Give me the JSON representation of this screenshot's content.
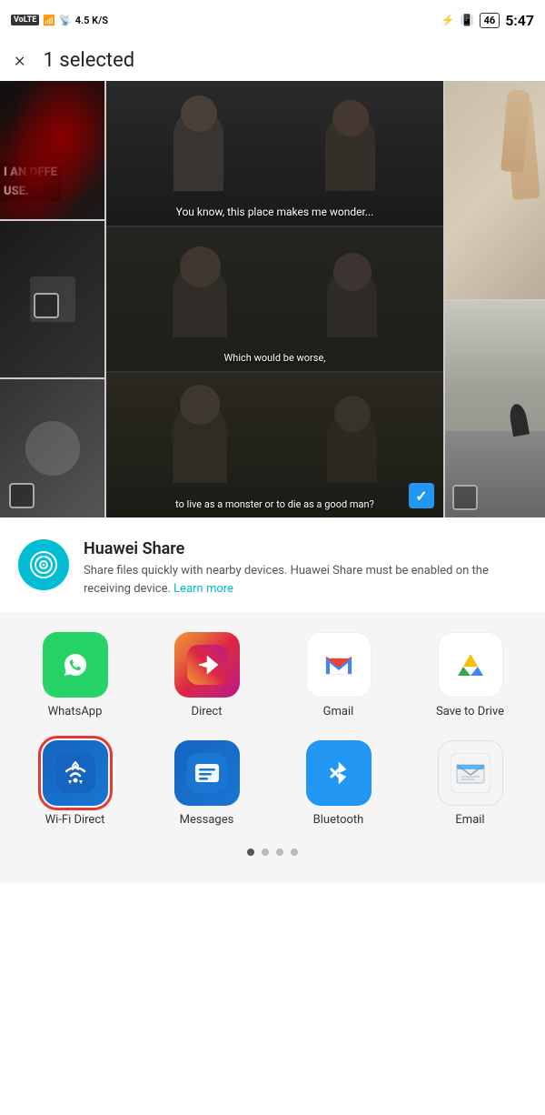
{
  "statusBar": {
    "left": {
      "volte": "VoLTE",
      "signal4g": "4G⁺",
      "speed": "4.5 K/S"
    },
    "right": {
      "bluetooth": "⚡",
      "battery": "46",
      "time": "5:47"
    }
  },
  "header": {
    "closeLabel": "×",
    "title": "1 selected"
  },
  "gallery": {
    "subtitles": [
      "You know, this place makes me wonder...",
      "Which would be worse,",
      "to live as a monster or to die as a good man?"
    ]
  },
  "huaweiShare": {
    "title": "Huawei Share",
    "description": "Share files quickly with nearby devices. Huawei Share must be enabled on the receiving device.",
    "learnMore": "Learn more"
  },
  "appsRow1": [
    {
      "id": "whatsapp",
      "label": "WhatsApp",
      "iconType": "whatsapp"
    },
    {
      "id": "direct",
      "label": "Direct",
      "iconType": "instagram"
    },
    {
      "id": "gmail",
      "label": "Gmail",
      "iconType": "gmail"
    },
    {
      "id": "drive",
      "label": "Save to Drive",
      "iconType": "drive"
    }
  ],
  "appsRow2": [
    {
      "id": "wifidirect",
      "label": "Wi-Fi Direct",
      "iconType": "wifidirect",
      "selected": true
    },
    {
      "id": "messages",
      "label": "Messages",
      "iconType": "messages"
    },
    {
      "id": "bluetooth",
      "label": "Bluetooth",
      "iconType": "bluetooth"
    },
    {
      "id": "email",
      "label": "Email",
      "iconType": "email"
    }
  ],
  "pagination": {
    "total": 4,
    "active": 0
  }
}
